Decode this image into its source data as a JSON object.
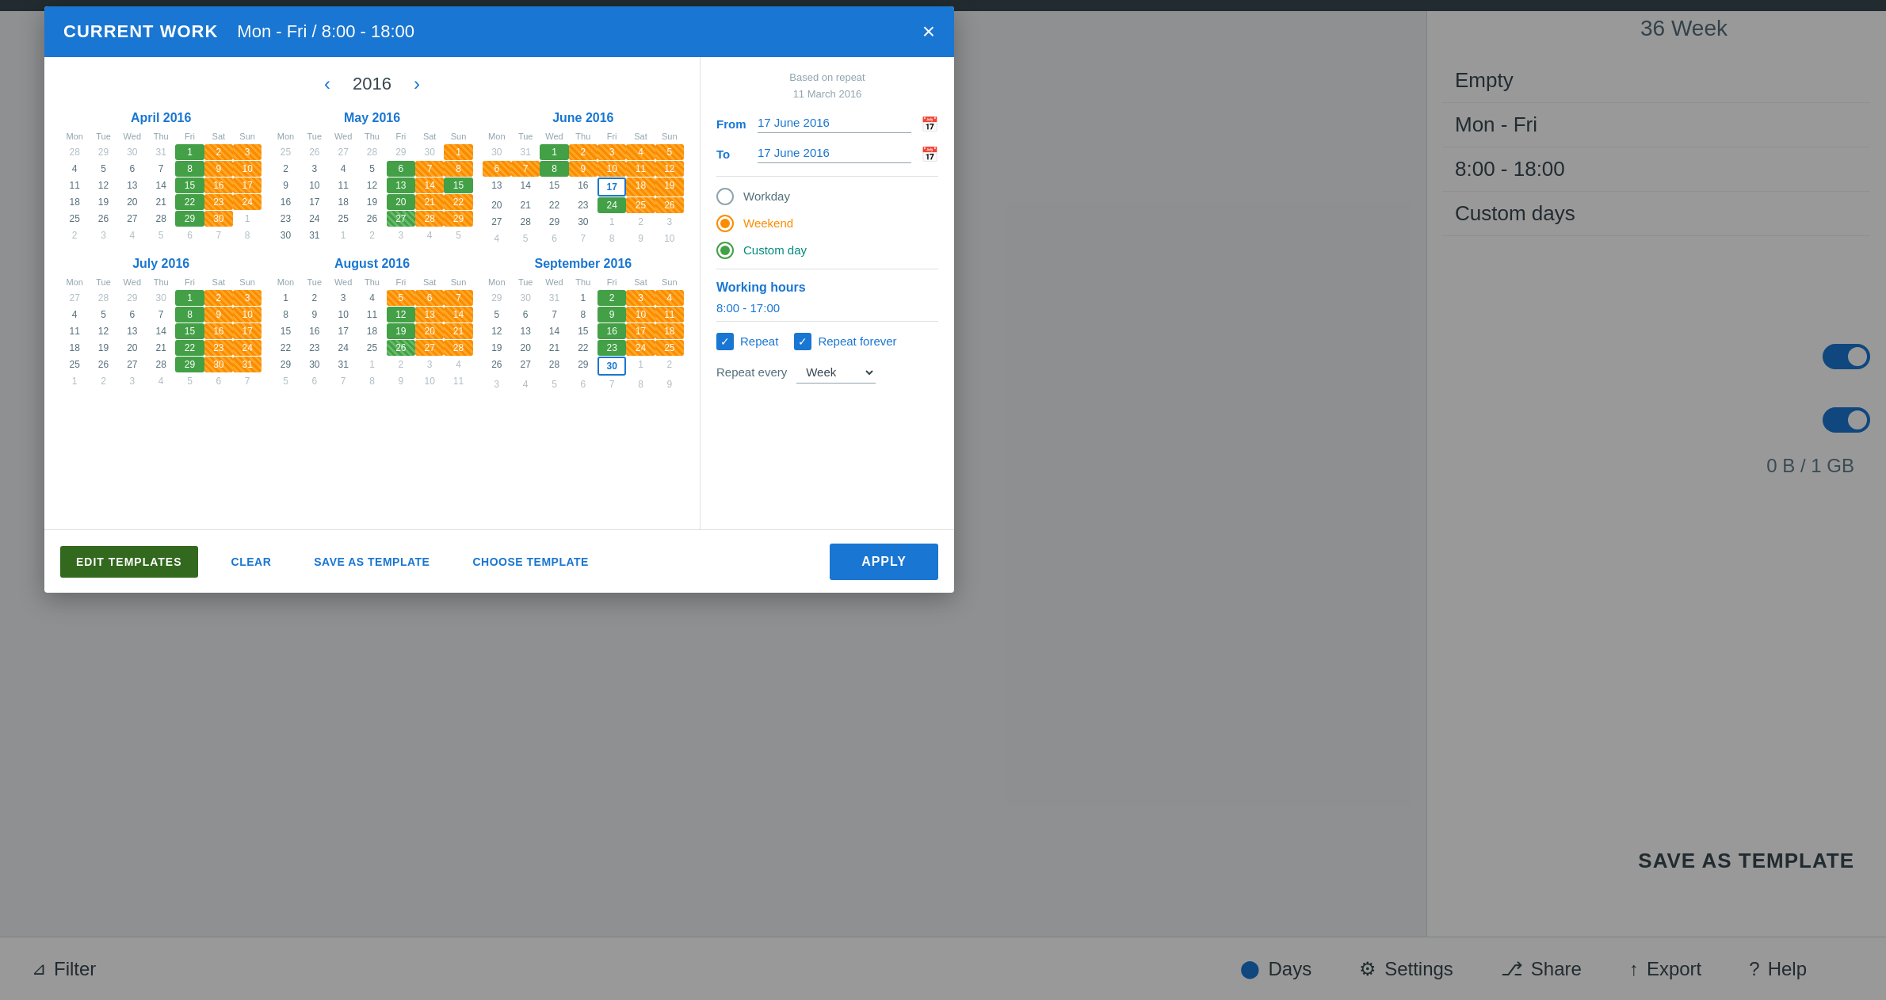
{
  "modal": {
    "title": "CURRENT WORK",
    "subtitle": "Mon - Fri / 8:00 - 18:00",
    "close_label": "×",
    "year": "2016",
    "months": [
      {
        "name": "April 2016",
        "headers": [
          "Mon",
          "Tue",
          "Wed",
          "Thu",
          "Fri",
          "Sat",
          "Sun"
        ],
        "rows": [
          [
            "28",
            "29",
            "30",
            "31",
            "1",
            "2",
            "3"
          ],
          [
            "4",
            "5",
            "6",
            "7",
            "8",
            "9",
            "10"
          ],
          [
            "11",
            "12",
            "13",
            "14",
            "15",
            "16",
            "17"
          ],
          [
            "18",
            "19",
            "20",
            "21",
            "22",
            "23",
            "24"
          ],
          [
            "25",
            "26",
            "27",
            "28",
            "29",
            "30",
            "1"
          ],
          [
            "2",
            "3",
            "4",
            "5",
            "6",
            "7",
            "8"
          ]
        ],
        "colored": {
          "1": "green",
          "2": "orange-stripe",
          "3": "orange-stripe",
          "8": "green",
          "9": "orange-stripe",
          "10": "orange-stripe",
          "15": "green",
          "16": "orange-stripe",
          "17": "orange-stripe",
          "22": "green",
          "23": "orange-stripe",
          "24": "orange-stripe",
          "29": "green",
          "30": "orange-stripe"
        }
      },
      {
        "name": "May 2016",
        "headers": [
          "Mon",
          "Tue",
          "Wed",
          "Thu",
          "Fri",
          "Sat",
          "Sun"
        ],
        "rows": [
          [
            "25",
            "26",
            "27",
            "28",
            "29",
            "30",
            "1"
          ],
          [
            "2",
            "3",
            "4",
            "5",
            "6",
            "7",
            "8"
          ],
          [
            "9",
            "10",
            "11",
            "12",
            "13",
            "14",
            "15"
          ],
          [
            "16",
            "17",
            "18",
            "19",
            "20",
            "21",
            "22"
          ],
          [
            "23",
            "24",
            "25",
            "26",
            "27",
            "28",
            "29"
          ],
          [
            "30",
            "31",
            "1",
            "2",
            "3",
            "4",
            "5"
          ]
        ],
        "colored": {
          "1": "orange-stripe",
          "6": "green",
          "7": "orange-stripe",
          "8": "orange-stripe",
          "13": "green",
          "14": "orange-stripe",
          "15": "green",
          "20": "green",
          "21": "orange-stripe",
          "22": "orange-stripe",
          "27": "green-stripe",
          "28": "orange-stripe",
          "29": "orange-stripe"
        }
      },
      {
        "name": "June 2016",
        "headers": [
          "Mon",
          "Tue",
          "Wed",
          "Thu",
          "Fri",
          "Sat",
          "Sun"
        ],
        "rows": [
          [
            "30",
            "31",
            "1",
            "2",
            "3",
            "4",
            "5"
          ],
          [
            "6",
            "7",
            "8",
            "9",
            "10",
            "11",
            "12"
          ],
          [
            "13",
            "14",
            "15",
            "16",
            "17",
            "18",
            "19"
          ],
          [
            "20",
            "21",
            "22",
            "23",
            "24",
            "25",
            "26"
          ],
          [
            "27",
            "28",
            "29",
            "30",
            "1",
            "2",
            "3"
          ],
          [
            "4",
            "5",
            "6",
            "7",
            "8",
            "9",
            "10"
          ]
        ],
        "colored": {
          "1": "green",
          "2": "orange-stripe",
          "3": "orange-stripe",
          "4": "orange-stripe",
          "5": "orange-stripe",
          "6": "orange-stripe",
          "7": "orange-stripe",
          "8": "green",
          "9": "orange-stripe",
          "10": "orange-stripe",
          "11": "orange-stripe",
          "12": "orange-stripe",
          "17": "today-highlight",
          "18": "orange-stripe",
          "19": "orange-stripe",
          "24": "green",
          "25": "orange-stripe",
          "26": "orange-stripe"
        }
      },
      {
        "name": "July 2016",
        "headers": [
          "Mon",
          "Tue",
          "Wed",
          "Thu",
          "Fri",
          "Sat",
          "Sun"
        ],
        "rows": [
          [
            "27",
            "28",
            "29",
            "30",
            "1",
            "2",
            "3"
          ],
          [
            "4",
            "5",
            "6",
            "7",
            "8",
            "9",
            "10"
          ],
          [
            "11",
            "12",
            "13",
            "14",
            "15",
            "16",
            "17"
          ],
          [
            "18",
            "19",
            "20",
            "21",
            "22",
            "23",
            "24"
          ],
          [
            "25",
            "26",
            "27",
            "28",
            "29",
            "30",
            "31"
          ],
          [
            "1",
            "2",
            "3",
            "4",
            "5",
            "6",
            "7"
          ]
        ],
        "colored": {
          "1": "green",
          "2": "orange-stripe",
          "3": "orange-stripe",
          "8": "green",
          "9": "orange-stripe",
          "10": "orange-stripe",
          "15": "green",
          "16": "orange-stripe",
          "17": "orange-stripe",
          "22": "green",
          "23": "orange-stripe",
          "24": "orange-stripe",
          "29": "green",
          "30": "orange-stripe",
          "31": "orange-stripe"
        }
      },
      {
        "name": "August 2016",
        "headers": [
          "Mon",
          "Tue",
          "Wed",
          "Thu",
          "Fri",
          "Sat",
          "Sun"
        ],
        "rows": [
          [
            "1",
            "2",
            "3",
            "4",
            "5",
            "6",
            "7"
          ],
          [
            "8",
            "9",
            "10",
            "11",
            "12",
            "13",
            "14"
          ],
          [
            "15",
            "16",
            "17",
            "18",
            "19",
            "20",
            "21"
          ],
          [
            "22",
            "23",
            "24",
            "25",
            "26",
            "27",
            "28"
          ],
          [
            "29",
            "30",
            "31",
            "1",
            "2",
            "3",
            "4"
          ],
          [
            "5",
            "6",
            "7",
            "8",
            "9",
            "10",
            "11"
          ]
        ],
        "colored": {
          "5": "orange-stripe",
          "6": "orange-stripe",
          "7": "orange-stripe",
          "12": "green",
          "13": "orange-stripe",
          "14": "orange-stripe",
          "19": "green",
          "20": "orange-stripe",
          "21": "orange-stripe",
          "26": "green-stripe",
          "27": "orange-stripe",
          "28": "orange-stripe"
        }
      },
      {
        "name": "September 2016",
        "headers": [
          "Mon",
          "Tue",
          "Wed",
          "Thu",
          "Fri",
          "Sat",
          "Sun"
        ],
        "rows": [
          [
            "29",
            "30",
            "31",
            "1",
            "2",
            "3",
            "4"
          ],
          [
            "5",
            "6",
            "7",
            "8",
            "9",
            "10",
            "11"
          ],
          [
            "12",
            "13",
            "14",
            "15",
            "16",
            "17",
            "18"
          ],
          [
            "19",
            "20",
            "21",
            "22",
            "23",
            "24",
            "25"
          ],
          [
            "26",
            "27",
            "28",
            "29",
            "30",
            "1",
            "2"
          ],
          [
            "3",
            "4",
            "5",
            "6",
            "7",
            "8",
            "9"
          ]
        ],
        "colored": {
          "2": "green",
          "3": "orange-stripe",
          "4": "orange-stripe",
          "9": "green",
          "10": "orange-stripe",
          "11": "orange-stripe",
          "16": "green",
          "17": "orange-stripe",
          "18": "orange-stripe",
          "23": "green",
          "24": "orange-stripe",
          "25": "orange-stripe",
          "30": "today-highlight"
        }
      }
    ],
    "right_panel": {
      "based_on_label": "Based on repeat",
      "based_on_date": "11 March 2016",
      "from_label": "From",
      "from_value": "17 June 2016",
      "to_label": "To",
      "to_value": "17 June 2016",
      "radio_options": [
        {
          "label": "Workday",
          "type": "default"
        },
        {
          "label": "Weekend",
          "type": "orange"
        },
        {
          "label": "Custom day",
          "type": "green-selected"
        }
      ],
      "working_hours_label": "Working hours",
      "working_hours_value": "8:00 - 17:00",
      "checkbox_repeat": "Repeat",
      "checkbox_repeat_forever": "Repeat forever",
      "repeat_every_label": "Repeat every",
      "repeat_every_value": "Week"
    },
    "footer": {
      "edit_templates_label": "EDIT TEMPLATES",
      "clear_label": "CLEAR",
      "save_as_template_label": "SAVE AS TEMPLATE",
      "choose_template_label": "CHOOSE TEMPLATE",
      "apply_label": "APPLY"
    }
  },
  "background": {
    "week_label": "36 Week",
    "empty_label": "Empty",
    "mon_fri_label": "Mon - Fri",
    "hours_label": "8:00 - 18:00",
    "custom_days_label": "Custom days",
    "storage_label": "0 B / 1 GB",
    "save_template_label": "SAVE AS TEMPLATE",
    "filter_label": "Filter",
    "settings_label": "Settings",
    "share_label": "Share",
    "export_label": "Export",
    "help_label": "Help",
    "days_label": "Days"
  }
}
